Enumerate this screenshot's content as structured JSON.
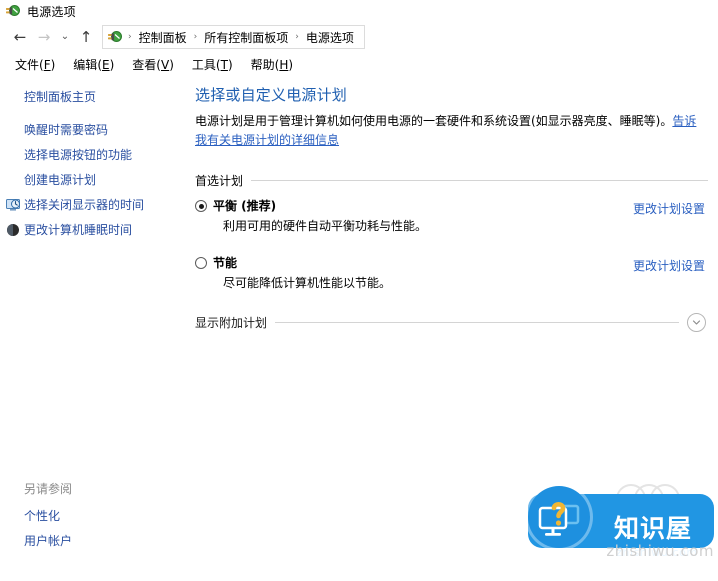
{
  "window": {
    "title": "电源选项",
    "icon": "power-plug-icon"
  },
  "nav": {
    "back_icon": "←",
    "forward_icon": "→",
    "history_icon": "⌄",
    "up_icon": "↑",
    "crumb_icon": "power-plug-icon",
    "separator": "›",
    "breadcrumbs": [
      "控制面板",
      "所有控制面板项",
      "电源选项"
    ]
  },
  "menubar": {
    "items": [
      {
        "text": "文件",
        "accel": "F"
      },
      {
        "text": "编辑",
        "accel": "E"
      },
      {
        "text": "查看",
        "accel": "V"
      },
      {
        "text": "工具",
        "accel": "T"
      },
      {
        "text": "帮助",
        "accel": "H"
      }
    ]
  },
  "sidebar": {
    "home": "控制面板主页",
    "items": [
      {
        "label": "唤醒时需要密码",
        "icon": null
      },
      {
        "label": "选择电源按钮的功能",
        "icon": null
      },
      {
        "label": "创建电源计划",
        "icon": null
      },
      {
        "label": "选择关闭显示器的时间",
        "icon": "monitor-clock-icon"
      },
      {
        "label": "更改计算机睡眠时间",
        "icon": "moon-icon"
      }
    ],
    "see_also_title": "另请参阅",
    "see_also": [
      "个性化",
      "用户帐户"
    ]
  },
  "main": {
    "title": "选择或自定义电源计划",
    "description_prefix": "电源计划是用于管理计算机如何使用电源的一套硬件和系统设置(如显示器亮度、睡眠等)。",
    "description_link": "告诉我有关电源计划的详细信息",
    "preferred_group": "首选计划",
    "plans": [
      {
        "name": "平衡 (推荐)",
        "description": "利用可用的硬件自动平衡功耗与性能。",
        "action": "更改计划设置",
        "selected": true
      },
      {
        "name": "节能",
        "description": "尽可能降低计算机性能以节能。",
        "action": "更改计划设置",
        "selected": false
      }
    ],
    "additional_plans_label": "显示附加计划",
    "additional_plans_chevron": "chevron-down-icon"
  },
  "watermark": {
    "brand_cn": "知识屋",
    "brand_url": "zhishiwu.com",
    "ghost_url": "zhishiwu.com",
    "icon": "monitor-question-icon",
    "color": "#2196e3"
  },
  "colors": {
    "link": "#2a5fc0",
    "sidebar_link": "#2a4fa0",
    "title": "#1f5fb0",
    "muted": "#8a8a8a"
  }
}
